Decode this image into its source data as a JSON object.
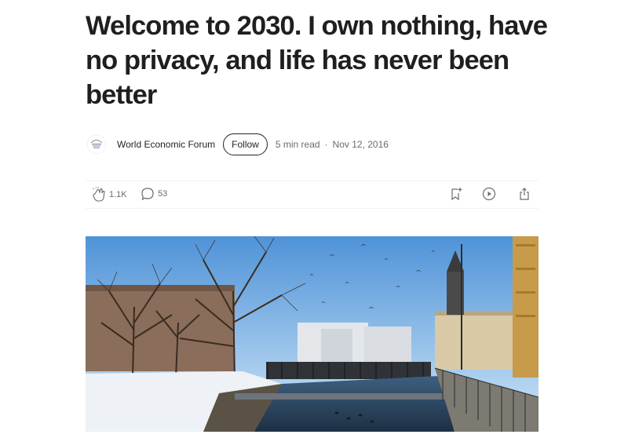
{
  "article": {
    "title": "Welcome to 2030. I own nothing, have no privacy, and life has never been better"
  },
  "byline": {
    "logo_icon": "world-economic-forum-logo",
    "author": "World Economic Forum",
    "follow_label": "Follow",
    "read_time": "5 min read",
    "separator": "·",
    "date": "Nov 12, 2016"
  },
  "actions": {
    "claps": "1.1K",
    "responses": "53",
    "icons": [
      "clap-icon",
      "comment-icon",
      "bookmark-add-icon",
      "play-icon",
      "share-icon"
    ]
  },
  "colors": {
    "text": "#242424",
    "muted": "#6b6b6b",
    "sky": "#8fc0ec",
    "water": "#2e4a66"
  }
}
